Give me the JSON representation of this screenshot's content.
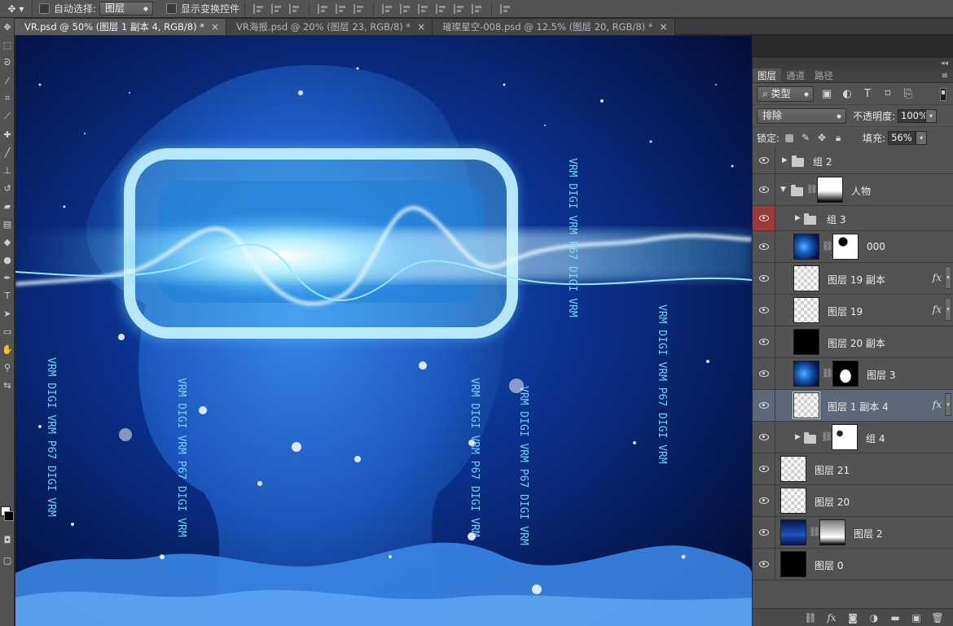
{
  "options_bar": {
    "tool_icon": "move-tool-icon",
    "auto_select_label": "自动选择:",
    "auto_select_value": "图层",
    "show_transform_label": "显示变换控件"
  },
  "tabs": [
    {
      "label": "VR.psd @ 50% (图层 1 副本 4, RGB/8) *",
      "close": "×",
      "active": true
    },
    {
      "label": "VR海报.psd @ 20% (图层 23, RGB/8) *",
      "close": "×",
      "active": false
    },
    {
      "label": "璀璨星空-008.psd @ 12.5% (图层 20, RGB/8) *",
      "close": "×",
      "active": false
    }
  ],
  "panel": {
    "collapse": "◂◂",
    "tabs": [
      "图层",
      "通道",
      "路径"
    ],
    "menu_icon": "≡",
    "filter_kind": "类型",
    "blend_mode": "排除",
    "opacity_label": "不透明度:",
    "opacity_value": "100%",
    "lock_label": "锁定:",
    "fill_label": "填充:",
    "fill_value": "56%"
  },
  "layers": [
    {
      "name": "组 2",
      "kind": "group",
      "expanded": false,
      "indent": 0
    },
    {
      "name": "人物",
      "kind": "group",
      "expanded": true,
      "indent": 0,
      "mask": "white-gradient"
    },
    {
      "name": "组 3",
      "kind": "group",
      "expanded": false,
      "indent": 1,
      "eye_color": "#9c3a3a"
    },
    {
      "name": "000",
      "kind": "layer",
      "thumb": "space",
      "mask": "black-white",
      "indent": 1
    },
    {
      "name": "图层 19 副本",
      "kind": "layer",
      "thumb": "trans",
      "fx": "fx",
      "indent": 1
    },
    {
      "name": "图层 19",
      "kind": "layer",
      "thumb": "trans",
      "fx": "fx",
      "indent": 1
    },
    {
      "name": "图层 20 副本",
      "kind": "layer",
      "thumb": "black",
      "indent": 1
    },
    {
      "name": "图层 3",
      "kind": "layer",
      "thumb": "space",
      "mask": "silhouette",
      "indent": 1
    },
    {
      "name": "图层 1 副本 4",
      "kind": "layer",
      "thumb": "trans",
      "fx": "fx",
      "indent": 1,
      "selected": true
    },
    {
      "name": "组 4",
      "kind": "group",
      "expanded": false,
      "indent": 1,
      "mask": "white"
    },
    {
      "name": "图层 21",
      "kind": "layer",
      "thumb": "trans",
      "indent": 0
    },
    {
      "name": "图层 20",
      "kind": "layer",
      "thumb": "trans",
      "indent": 0
    },
    {
      "name": "图层 2",
      "kind": "layer",
      "thumb": "space",
      "mask": "gradient",
      "indent": 0
    },
    {
      "name": "图层 0",
      "kind": "layer",
      "thumb": "black",
      "indent": 0
    }
  ],
  "canvas": {
    "code_text": "VRM DIGI VRM P67 DIGI VRM"
  },
  "colors": {
    "ui_bg": "#535353",
    "canvas_bg": "#030b2c",
    "glow": "#7fe0ff",
    "selection": "#5d6878"
  }
}
